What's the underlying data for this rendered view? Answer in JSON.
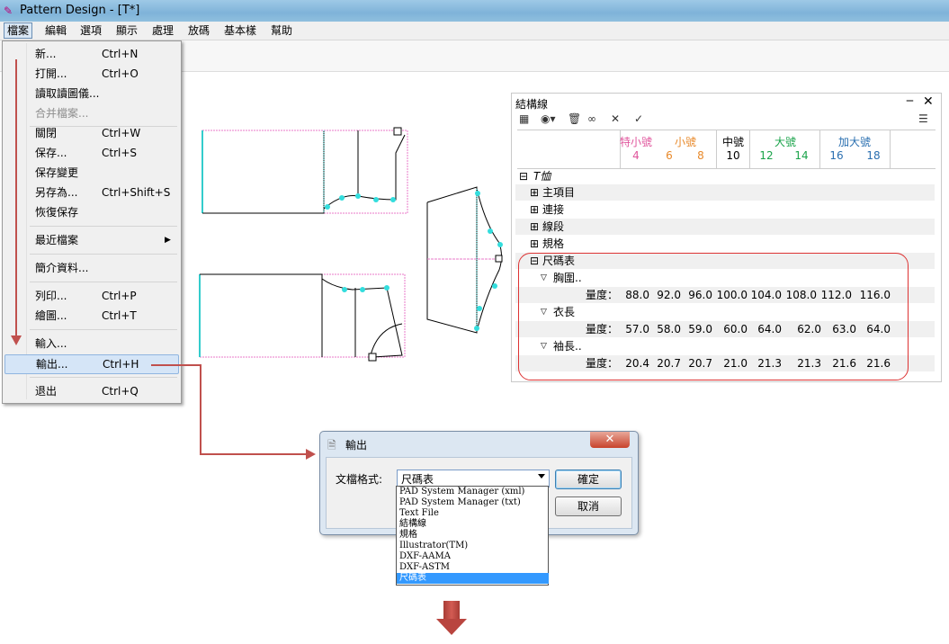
{
  "window": {
    "title": "Pattern Design - [T*]"
  },
  "menubar": [
    "檔案",
    "編輯",
    "選項",
    "顯示",
    "處理",
    "放碼",
    "基本樣",
    "幫助"
  ],
  "file_menu": {
    "items": [
      {
        "label": "新...",
        "shortcut": "Ctrl+N"
      },
      {
        "label": "打開...",
        "shortcut": "Ctrl+O"
      },
      {
        "label": "讀取讀圖儀...",
        "shortcut": ""
      },
      {
        "label": "合并檔案...",
        "shortcut": ""
      },
      {
        "label": "關閉",
        "shortcut": "Ctrl+W"
      },
      {
        "label": "保存...",
        "shortcut": "Ctrl+S"
      },
      {
        "label": "保存變更",
        "shortcut": ""
      },
      {
        "label": "另存為...",
        "shortcut": "Ctrl+Shift+S"
      },
      {
        "label": "恢復保存",
        "shortcut": ""
      },
      {
        "label": "最近檔案",
        "shortcut": ""
      },
      {
        "label": "簡介資料...",
        "shortcut": ""
      },
      {
        "label": "列印...",
        "shortcut": "Ctrl+P"
      },
      {
        "label": "繪圖...",
        "shortcut": "Ctrl+T"
      },
      {
        "label": "輸入...",
        "shortcut": ""
      },
      {
        "label": "輸出...",
        "shortcut": "Ctrl+H"
      },
      {
        "label": "退出",
        "shortcut": "Ctrl+Q"
      }
    ]
  },
  "panel": {
    "title": "結構線",
    "size_groups": [
      {
        "name": "特小號",
        "sizes": [
          "4"
        ],
        "color": "#e0559c"
      },
      {
        "name": "小號",
        "sizes": [
          "6",
          "8"
        ],
        "color": "#e8892a"
      },
      {
        "name": "中號",
        "sizes": [
          "10"
        ],
        "color": "#000000"
      },
      {
        "name": "大號",
        "sizes": [
          "12",
          "14"
        ],
        "color": "#1aa34a"
      },
      {
        "name": "加大號",
        "sizes": [
          "16",
          "18"
        ],
        "color": "#2a6fb0"
      }
    ],
    "tree": {
      "root": "T恤",
      "nodes": [
        "主項目",
        "連接",
        "線段",
        "規格",
        "尺碼表"
      ],
      "measure_label": "量度：",
      "measures": [
        {
          "name": "胸圍..",
          "values": [
            "88.0",
            "92.0",
            "96.0",
            "100.0",
            "104.0",
            "108.0",
            "112.0",
            "116.0"
          ]
        },
        {
          "name": "衣長",
          "values": [
            "57.0",
            "58.0",
            "59.0",
            "60.0",
            "64.0",
            "62.0",
            "63.0",
            "64.0"
          ]
        },
        {
          "name": "袖長..",
          "values": [
            "20.4",
            "20.7",
            "20.7",
            "21.0",
            "21.3",
            "21.3",
            "21.6",
            "21.6"
          ]
        }
      ]
    }
  },
  "dialog": {
    "title": "輸出",
    "format_label": "文檔格式:",
    "selected": "尺碼表",
    "ok": "確定",
    "cancel": "取消",
    "options": [
      "PAD System Manager (xml)",
      "PAD System Manager (txt)",
      "Text File",
      "結構線",
      "規格",
      "Illustrator(TM)",
      "DXF-AAMA",
      "DXF-ASTM",
      "尺碼表"
    ]
  },
  "colors": {
    "annotation_arrow": "#c0504d",
    "highlight_box": "#dd3333",
    "selection": "#3399ff"
  }
}
